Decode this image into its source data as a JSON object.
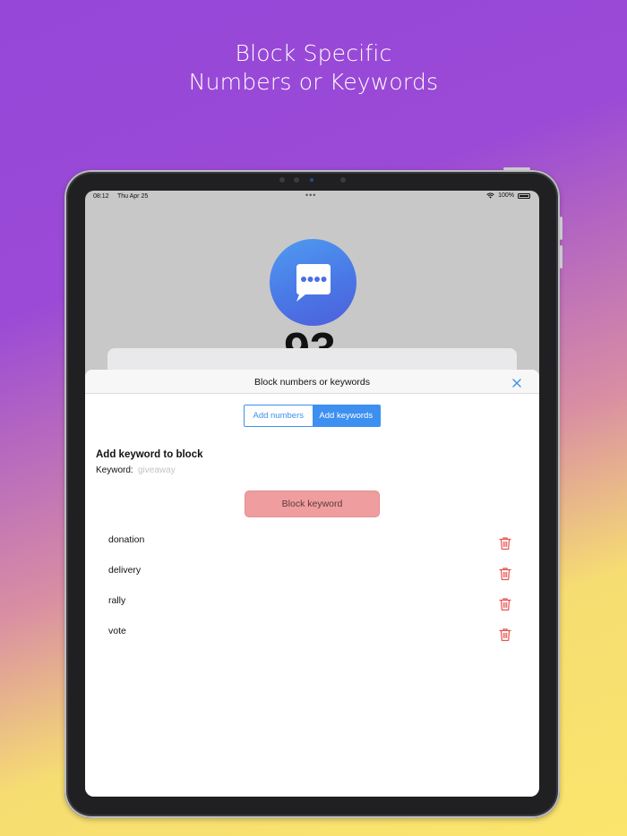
{
  "headline": {
    "line1": "Block Specific",
    "line2": "Numbers or Keywords"
  },
  "status_bar": {
    "time": "08:12",
    "date": "Thu Apr 25",
    "dots": "•••",
    "battery": "100%"
  },
  "background_app": {
    "icon": "chat-bubble-icon",
    "partial_number": "93"
  },
  "sheet": {
    "title": "Block numbers or keywords",
    "close_icon": "close-icon",
    "tabs": [
      {
        "label": "Add numbers",
        "selected": false
      },
      {
        "label": "Add keywords",
        "selected": true
      }
    ],
    "form_title": "Add keyword to block",
    "keyword_label": "Keyword:",
    "keyword_value": "",
    "keyword_placeholder": "giveaway",
    "block_button": "Block keyword",
    "keywords": [
      {
        "text": "donation",
        "icon": "trash-icon"
      },
      {
        "text": "delivery",
        "icon": "trash-icon"
      },
      {
        "text": "rally",
        "icon": "trash-icon"
      },
      {
        "text": "vote",
        "icon": "trash-icon"
      }
    ]
  },
  "colors": {
    "accent": "#3d8ff0",
    "block_button": "#ef9d9f",
    "trash": "#e8534f"
  }
}
